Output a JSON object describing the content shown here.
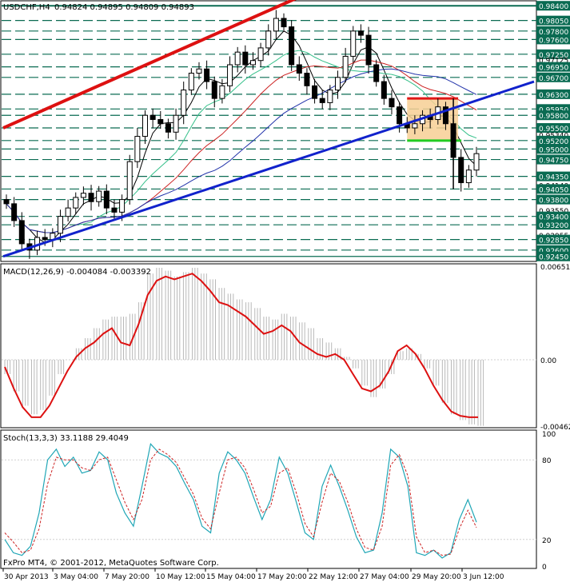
{
  "header": {
    "symbol_text": "USDCHF,H4",
    "ohlc_text": "0.94824 0.94895 0.94809 0.94893"
  },
  "copyright": "FxPro MT4, © 2001-2012, MetaQuotes Software Corp.",
  "colors": {
    "bull": "#000000",
    "bear": "#000000",
    "level_line": "#0a6b52",
    "level_label_bg": "#0a6b52",
    "level_label_text": "#ffffff",
    "channel_red": "#dd1111",
    "trend_blue": "#1122cc",
    "ma_black": "#000000",
    "ma_green": "#35c08a",
    "ma_red": "#cc2222",
    "ma_blue": "#2233aa",
    "macd_signal": "#dd1111",
    "macd_hist": "#b8b8b8",
    "stoch_main": "#1fa6b6",
    "stoch_signal": "#cc2222",
    "rect_fill": "#f7cf94",
    "rect_top": "#e01818",
    "rect_bottom": "#22cc22"
  },
  "chart_data": [
    {
      "type": "candlestick",
      "name": "price",
      "title": "USDCHF,H4",
      "ylim": [
        0.9235,
        0.9848
      ],
      "x_ticks": [
        "30 Apr 2013",
        "3 May 04:00",
        "7 May 20:00",
        "10 May 12:00",
        "15 May 04:00",
        "17 May 20:00",
        "22 May 12:00",
        "27 May 04:00",
        "29 May 20:00",
        "3 Jun 12:00"
      ],
      "levels": [
        "0.98400",
        "0.98050",
        "0.97800",
        "0.97600",
        "0.97250",
        "0.96950",
        "0.96700",
        "0.96300",
        "0.95950",
        "0.95800",
        "0.95500",
        "0.95200",
        "0.95000",
        "0.94750",
        "0.94350",
        "0.94050",
        "0.93800",
        "0.93400",
        "0.93200",
        "0.92850",
        "0.92600",
        "0.92450"
      ],
      "right_labels": [
        "0.98400",
        "0.98050",
        "0.97800",
        "0.97600",
        "0.97250",
        "0.97125",
        "0.96950",
        "0.96700",
        "0.96300",
        "0.95950",
        "0.95800",
        "0.95500",
        "0.95340",
        "0.95200",
        "0.95000",
        "0.94750",
        "0.94350",
        "0.94140",
        "0.94050",
        "0.93800",
        "0.93550",
        "0.93400",
        "0.93200",
        "0.92955",
        "0.92850",
        "0.92600",
        "0.92450"
      ],
      "candle_close_path": [
        0.937,
        0.933,
        0.9275,
        0.926,
        0.929,
        0.9285,
        0.93,
        0.934,
        0.936,
        0.9385,
        0.9395,
        0.9375,
        0.94,
        0.936,
        0.935,
        0.938,
        0.947,
        0.953,
        0.958,
        0.957,
        0.956,
        0.954,
        0.958,
        0.964,
        0.968,
        0.969,
        0.966,
        0.962,
        0.965,
        0.97,
        0.973,
        0.97,
        0.971,
        0.974,
        0.978,
        0.981,
        0.979,
        0.97,
        0.968,
        0.965,
        0.962,
        0.961,
        0.964,
        0.967,
        0.972,
        0.978,
        0.977,
        0.97,
        0.966,
        0.962,
        0.96,
        0.956,
        0.955,
        0.956,
        0.958,
        0.957,
        0.96,
        0.956,
        0.948,
        0.942,
        0.945,
        0.9489
      ],
      "overlays": [
        {
          "name": "channel-top",
          "from": [
            0,
            0.955
          ],
          "to": [
            60,
            0.994
          ]
        },
        {
          "name": "trend-support",
          "from": [
            0,
            0.9245
          ],
          "to": [
            100,
            0.966
          ]
        },
        {
          "name": "zone-top",
          "value": 0.962
        },
        {
          "name": "zone-bottom",
          "value": 0.952
        }
      ]
    },
    {
      "type": "line",
      "name": "macd",
      "title": "MACD(12,26,9) -0.004084 -0.003392",
      "ylim": [
        -0.00462,
        0.006511
      ],
      "tick_labels": [
        "0.006511",
        "0.00",
        "-0.00462"
      ],
      "series": [
        {
          "name": "histogram",
          "values": [
            -0.001,
            -0.0022,
            -0.0032,
            -0.0038,
            -0.0035,
            -0.0025,
            -0.001,
            0.0,
            0.0008,
            0.0015,
            0.0022,
            0.0028,
            0.003,
            0.003,
            0.0032,
            0.004,
            0.006,
            0.0064,
            0.0062,
            0.0058,
            0.0061,
            0.0064,
            0.006,
            0.0056,
            0.005,
            0.0046,
            0.0042,
            0.004,
            0.0036,
            0.003,
            0.0028,
            0.0032,
            0.003,
            0.0026,
            0.0022,
            0.0015,
            0.0012,
            0.0008,
            0.0002,
            -0.0006,
            -0.0018,
            -0.0026,
            -0.002,
            -0.001,
            0.0006,
            0.0008,
            0.0004,
            -0.0006,
            -0.0018,
            -0.003,
            -0.0038,
            -0.0042,
            -0.0045,
            -0.0046
          ]
        },
        {
          "name": "signal",
          "values": [
            -0.0005,
            -0.002,
            -0.0033,
            -0.004,
            -0.004,
            -0.0032,
            -0.002,
            -0.0008,
            0.0002,
            0.0008,
            0.0012,
            0.0018,
            0.0022,
            0.0012,
            0.001,
            0.0025,
            0.0045,
            0.0055,
            0.0058,
            0.0056,
            0.0058,
            0.006,
            0.0055,
            0.0048,
            0.004,
            0.0038,
            0.0034,
            0.003,
            0.0024,
            0.0018,
            0.002,
            0.0024,
            0.002,
            0.0012,
            0.0008,
            0.0004,
            0.0002,
            0.0004,
            0.0,
            -0.001,
            -0.002,
            -0.0022,
            -0.0018,
            -0.0008,
            0.0006,
            0.001,
            0.0004,
            -0.0006,
            -0.0018,
            -0.0028,
            -0.0036,
            -0.0039,
            -0.004,
            -0.004
          ]
        }
      ]
    },
    {
      "type": "line",
      "name": "stochastic",
      "title": "Stoch(13,3,3) 33.1188 29.4049",
      "ylim": [
        0,
        100
      ],
      "tick_labels": [
        "100",
        "80",
        "20",
        "0"
      ],
      "series": [
        {
          "name": "main",
          "values": [
            20,
            10,
            8,
            15,
            40,
            80,
            88,
            75,
            82,
            70,
            72,
            86,
            80,
            55,
            40,
            30,
            60,
            92,
            85,
            82,
            75,
            62,
            50,
            30,
            25,
            70,
            86,
            80,
            70,
            52,
            35,
            50,
            82,
            70,
            48,
            25,
            20,
            60,
            76,
            60,
            42,
            22,
            10,
            12,
            40,
            88,
            82,
            60,
            10,
            8,
            12,
            6,
            10,
            35,
            50,
            33
          ]
        },
        {
          "name": "signal",
          "values": [
            25,
            18,
            10,
            12,
            28,
            62,
            82,
            80,
            80,
            74,
            72,
            80,
            82,
            65,
            48,
            35,
            50,
            80,
            88,
            84,
            78,
            66,
            54,
            36,
            28,
            55,
            80,
            82,
            74,
            58,
            40,
            45,
            70,
            74,
            55,
            32,
            22,
            48,
            70,
            64,
            48,
            28,
            14,
            12,
            30,
            76,
            84,
            68,
            22,
            10,
            12,
            8,
            9,
            28,
            42,
            29
          ]
        }
      ]
    }
  ]
}
